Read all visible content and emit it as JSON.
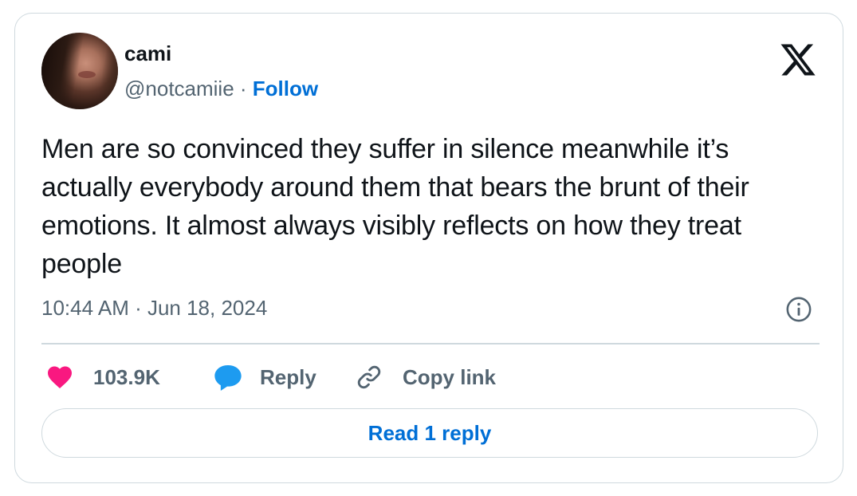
{
  "author": {
    "name": "cami",
    "handle": "@notcamiie",
    "separator": " · ",
    "follow_label": "Follow"
  },
  "tweet": {
    "text": "Men are so convinced they suffer in silence meanwhile it’s actually everybody around them that bears the brunt of their emotions. It almost always visibly reflects on how they treat people",
    "timestamp": "10:44 AM · Jun 18, 2024"
  },
  "actions": {
    "likes_count": "103.9K",
    "reply_label": "Reply",
    "copy_link_label": "Copy link"
  },
  "read_replies_label": "Read 1 reply",
  "icons": {
    "brand": "x-logo-icon",
    "info": "info-icon",
    "like": "heart-icon",
    "reply": "speech-bubble-icon",
    "copy": "link-icon"
  },
  "colors": {
    "text": "#0f1419",
    "secondary": "#536471",
    "link": "#006fd6",
    "like": "#f91880",
    "reply": "#1d9bf0",
    "border": "#cfd9de"
  }
}
